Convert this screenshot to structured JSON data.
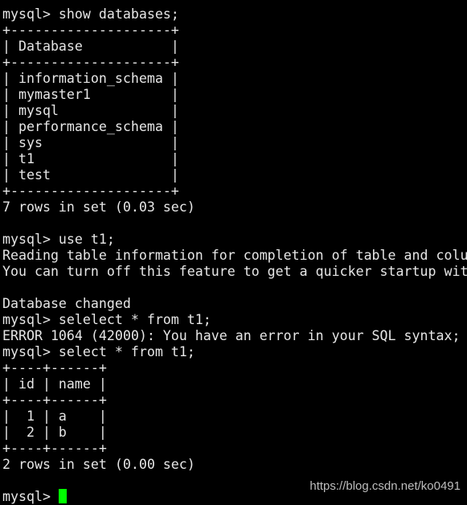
{
  "terminal": {
    "lines": [
      "mysql> show databases;",
      "+--------------------+",
      "| Database           |",
      "+--------------------+",
      "| information_schema |",
      "| mymaster1          |",
      "| mysql              |",
      "| performance_schema |",
      "| sys                |",
      "| t1                 |",
      "| test               |",
      "+--------------------+",
      "7 rows in set (0.03 sec)",
      "",
      "mysql> use t1;",
      "Reading table information for completion of table and colu",
      "You can turn off this feature to get a quicker startup wit",
      "",
      "Database changed",
      "mysql> selelect * from t1;",
      "ERROR 1064 (42000): You have an error in your SQL syntax;",
      "mysql> select * from t1;",
      "+----+------+",
      "| id | name |",
      "+----+------+",
      "|  1 | a    |",
      "|  2 | b    |",
      "+----+------+",
      "2 rows in set (0.00 sec)",
      ""
    ],
    "prompt": "mysql> ",
    "cursor_color": "#00ff00"
  },
  "watermark": "https://blog.csdn.net/ko0491"
}
